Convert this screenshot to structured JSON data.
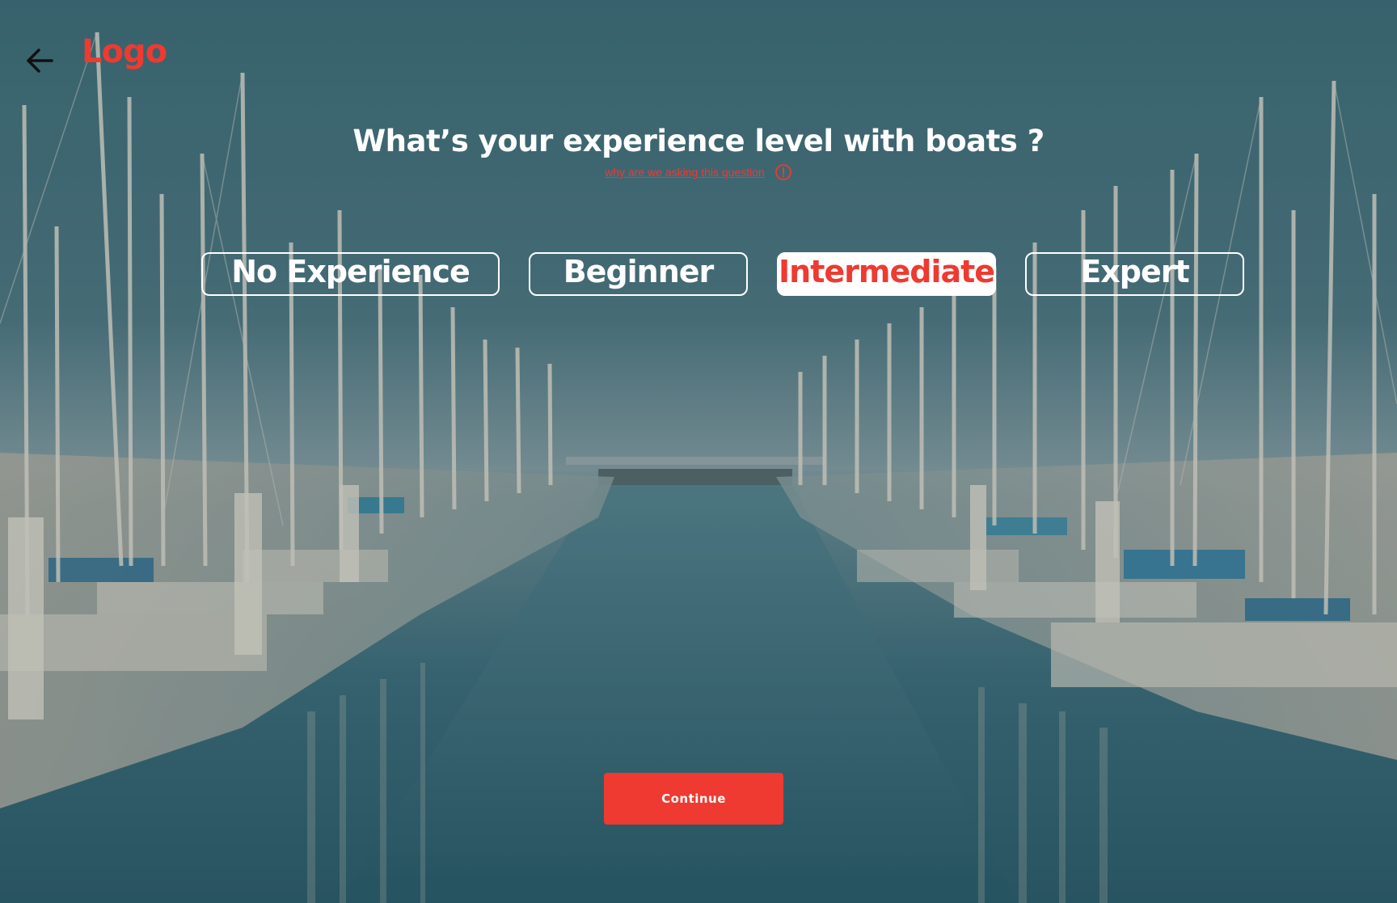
{
  "header": {
    "back_icon": "arrow-left-icon",
    "logo_text": "Logo"
  },
  "question": {
    "title": "What’s your experience level with boats ?",
    "why_link": "why are we asking this question",
    "info_icon": "info-circle-icon"
  },
  "options": [
    {
      "label": "No Experience",
      "selected": false
    },
    {
      "label": "Beginner",
      "selected": false
    },
    {
      "label": "Intermediate",
      "selected": true
    },
    {
      "label": "Expert",
      "selected": false
    }
  ],
  "continue": {
    "label": "Continue"
  },
  "colors": {
    "accent": "#ee3a31",
    "text": "#ffffff",
    "back_icon": "#111111"
  }
}
